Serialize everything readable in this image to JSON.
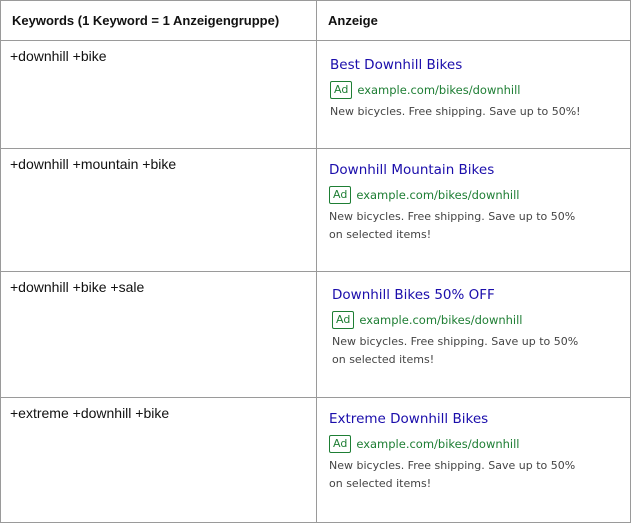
{
  "table": {
    "headers": [
      "Keywords (1 Keyword = 1 Anzeigengruppe)",
      "Anzeige"
    ],
    "rows": [
      {
        "keyword": "+downhill +bike",
        "ad": {
          "title": "Best Downhill Bikes",
          "badge": "Ad",
          "url": "example.com/bikes/downhill",
          "description": "New bicycles. Free shipping. Save up to 50%!"
        }
      },
      {
        "keyword": "+downhill +mountain +bike",
        "ad": {
          "title": "Downhill Mountain Bikes",
          "badge": "Ad",
          "url": "example.com/bikes/downhill",
          "description": "New bicycles. Free shipping. Save up to 50% on selected items!"
        }
      },
      {
        "keyword": "+downhill +bike +sale",
        "ad": {
          "title": "Downhill Bikes 50% OFF",
          "badge": "Ad",
          "url": "example.com/bikes/downhill",
          "description": "New bicycles. Free shipping. Save up to 50% on selected items!"
        }
      },
      {
        "keyword": "+extreme +downhill +bike",
        "ad": {
          "title": "Extreme Downhill Bikes",
          "badge": "Ad",
          "url": "example.com/bikes/downhill",
          "description": "New bicycles. Free shipping. Save up to 50% on selected items!"
        }
      }
    ]
  },
  "colors": {
    "ad_title": "#1a0dab",
    "ad_url": "#1e7e34",
    "border": "#9a9a9a"
  }
}
